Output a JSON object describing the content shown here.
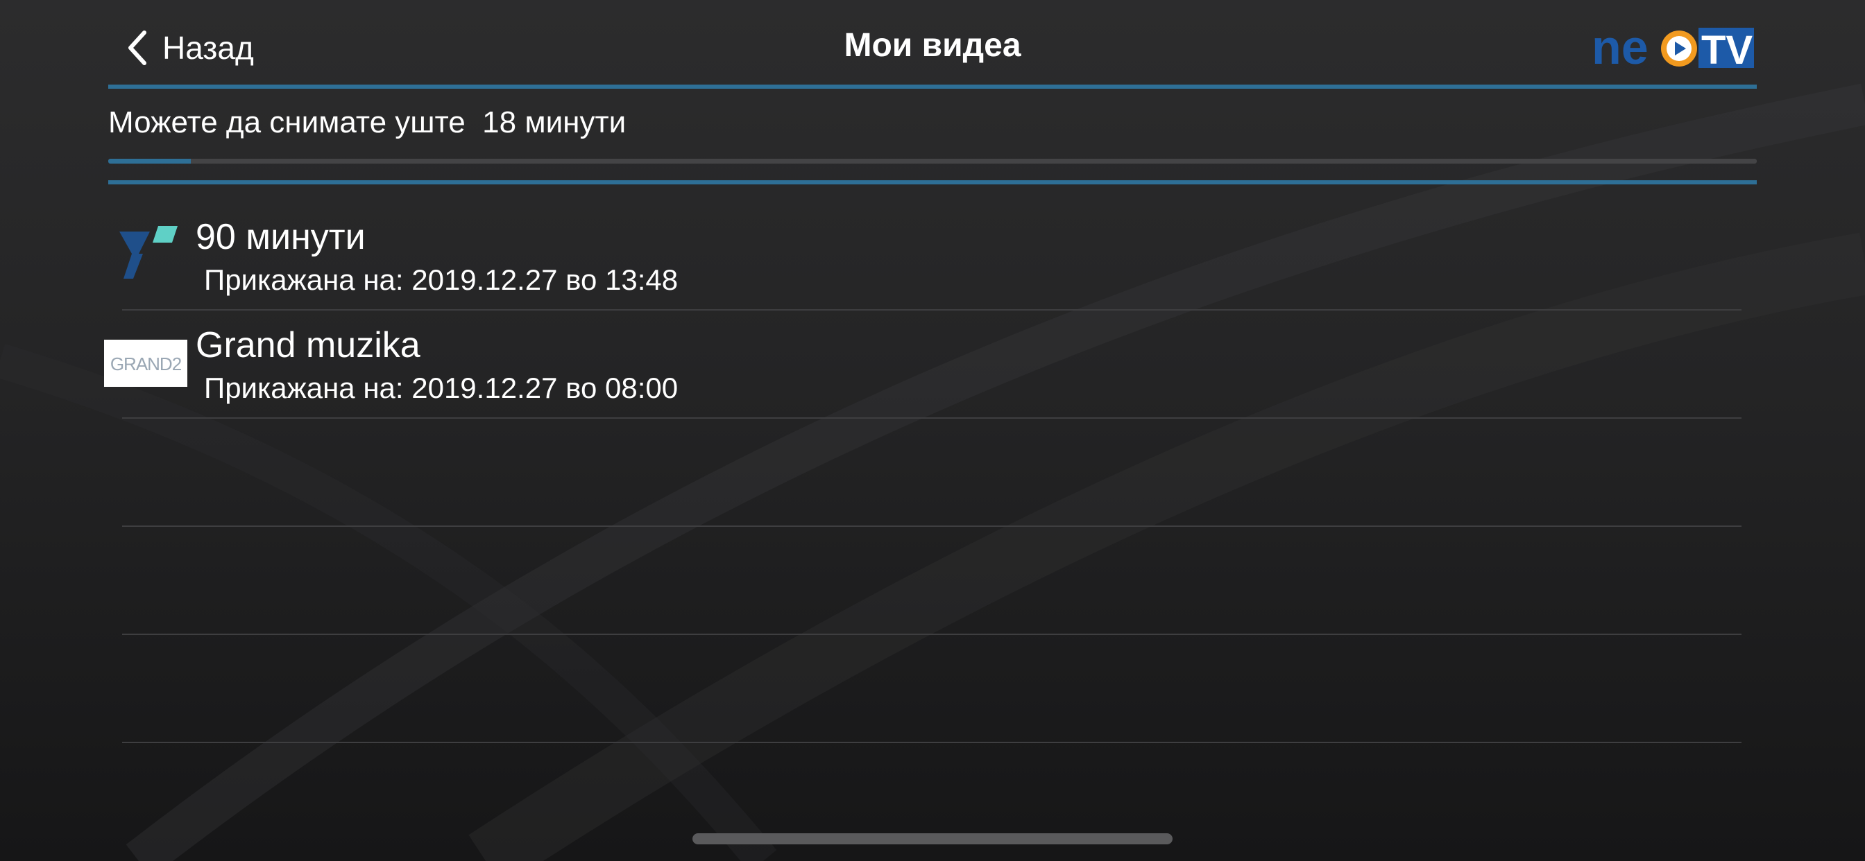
{
  "header": {
    "back_label": "Назад",
    "title": "Мои видеа",
    "logo_text_left": "ne",
    "logo_text_right": "TV"
  },
  "quota": {
    "label": "Можете да снимате уште  18 минути",
    "fill_fraction": 0.05
  },
  "videos": [
    {
      "title": "90 минути",
      "subtitle": "Прикажана на: 2019.12.27 во 13:48",
      "channel_icon": "tv-channel-logo"
    },
    {
      "title": "Grand muzika",
      "subtitle": "Прикажана на: 2019.12.27 во 08:00",
      "channel_icon": "grand2-channel-logo",
      "channel_logo_text": "GRAND2"
    }
  ],
  "empty_rows": 3,
  "colors": {
    "accent": "#2e6f96",
    "logo_blue": "#1d5aa8",
    "logo_orange": "#f29a1f",
    "tv_logo_dark": "#1f4f8a",
    "tv_logo_teal": "#5fd0c6"
  }
}
